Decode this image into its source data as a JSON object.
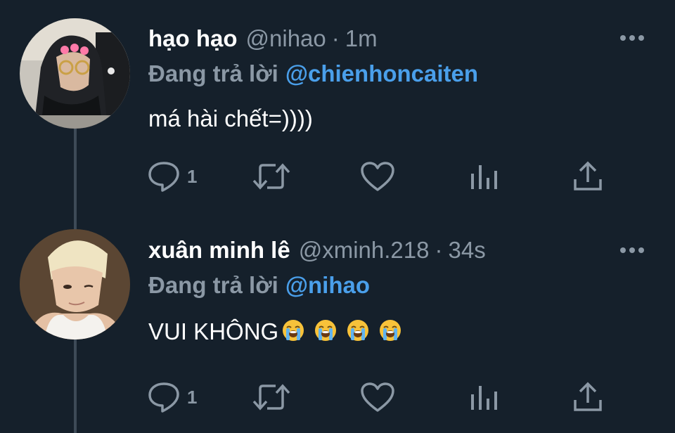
{
  "tweets": [
    {
      "display_name": "hạo hạo",
      "handle": "@nihao",
      "separator": "·",
      "time": "1m",
      "reply_prefix": "Đang trả lời",
      "reply_to": "@chienhoncaiten",
      "text": "má hài chết=))))",
      "reply_count": "1",
      "avatar_icon": "avatar-photo-hoodie"
    },
    {
      "display_name": "xuân minh lê",
      "handle": "@xminh.218",
      "separator": "·",
      "time": "34s",
      "reply_prefix": "Đang trả lời",
      "reply_to": "@nihao",
      "text": "VUI KHÔNG",
      "emoji_count": 4,
      "emoji_icon": "loudly-crying-face",
      "reply_count": "1",
      "avatar_icon": "avatar-photo-blond"
    }
  ],
  "colors": {
    "background": "#15202b",
    "secondary_text": "#8b98a5",
    "mention": "#4a9fea",
    "thread_line": "#3d4a57"
  },
  "icons": {
    "reply": "speech-bubble-icon",
    "retweet": "retweet-arrows-icon",
    "like": "heart-icon",
    "views": "bar-chart-icon",
    "share": "share-upload-icon",
    "more": "more-dots-icon"
  }
}
